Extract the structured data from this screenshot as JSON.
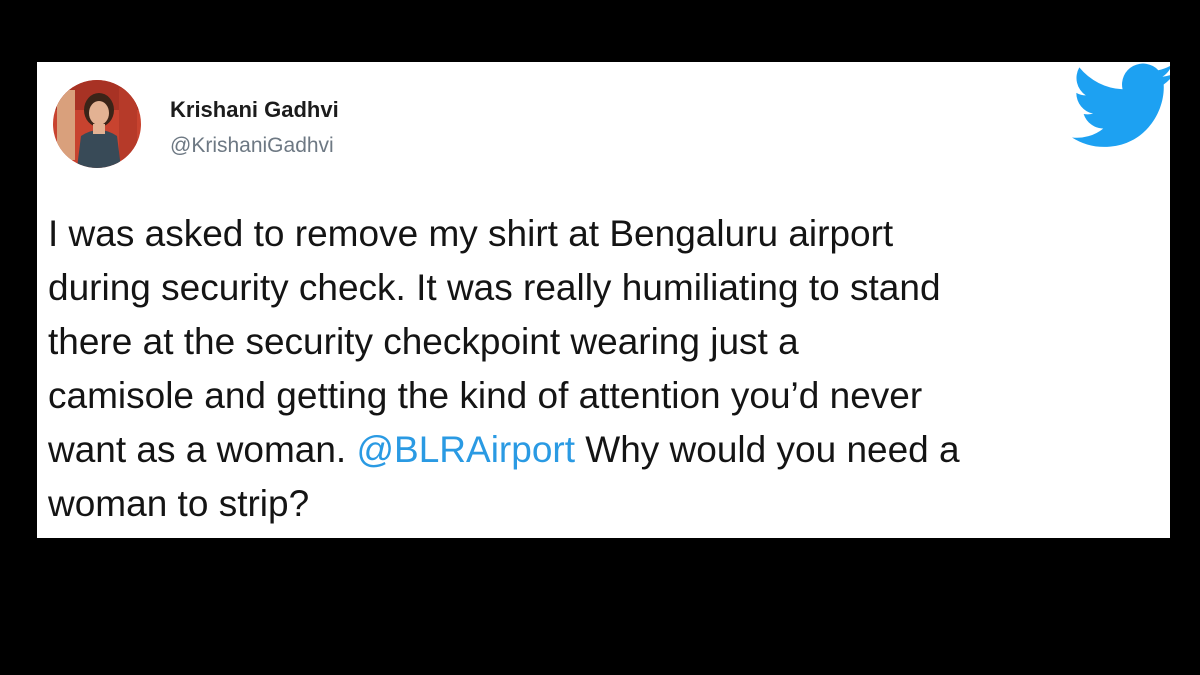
{
  "tweet": {
    "author": {
      "display_name": "Krishani Gadhvi",
      "handle": "@KrishaniGadhvi"
    },
    "body": {
      "line1": "I was asked to remove my shirt at Bengaluru airport",
      "line2": "during security check. It was really humiliating to stand",
      "line3": "there at the security checkpoint wearing just a",
      "line4": "camisole and getting the kind of attention you’d never",
      "line5_before": "want as a woman. ",
      "line5_mention": "@BLRAirport",
      "line5_after": " Why would you need a",
      "line6": "woman to strip?"
    }
  },
  "icons": {
    "brand": "twitter-bird-icon"
  },
  "colors": {
    "background": "#000000",
    "card": "#ffffff",
    "text": "#141414",
    "handle": "#6d7883",
    "mention": "#2a9ae3",
    "twitter_blue": "#1da1f2"
  }
}
